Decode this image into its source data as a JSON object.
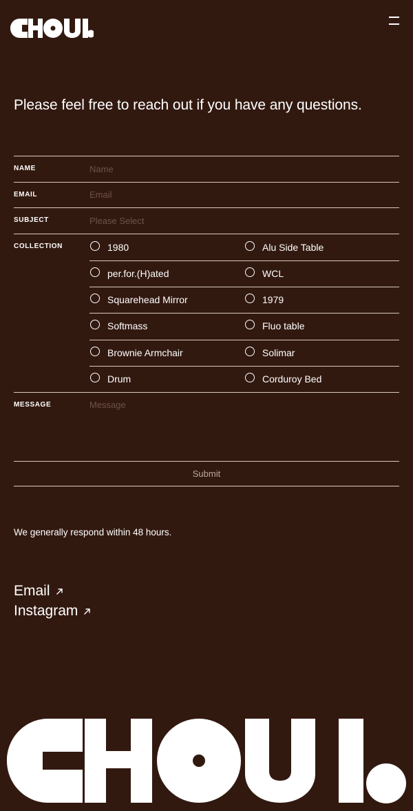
{
  "brand": {
    "logo_text": "CHOUI."
  },
  "intro": "Please feel free to reach out if you have any questions.",
  "form": {
    "name": {
      "label": "NAME",
      "placeholder": "Name"
    },
    "email": {
      "label": "EMAIL",
      "placeholder": "Email"
    },
    "subject": {
      "label": "SUBJECT",
      "placeholder": "Please Select"
    },
    "collection": {
      "label": "COLLECTION",
      "options": [
        [
          "1980",
          "Alu Side Table"
        ],
        [
          "per.for.(H)ated",
          "WCL"
        ],
        [
          "Squarehead Mirror",
          "1979"
        ],
        [
          "Softmass",
          "Fluo table"
        ],
        [
          "Brownie Armchair",
          "Solimar"
        ],
        [
          "Drum",
          "Corduroy Bed"
        ]
      ]
    },
    "message": {
      "label": "MESSAGE",
      "placeholder": "Message"
    },
    "submit_label": "Submit"
  },
  "respond_note": "We generally respond within 48 hours.",
  "links": [
    {
      "label": "Email",
      "icon": "arrow-up-right-icon"
    },
    {
      "label": "Instagram",
      "icon": "arrow-up-right-icon"
    }
  ],
  "colors": {
    "background": "#321910",
    "text": "#ffffff",
    "divider": "#d9cbc3",
    "placeholder": "#6d5247"
  }
}
